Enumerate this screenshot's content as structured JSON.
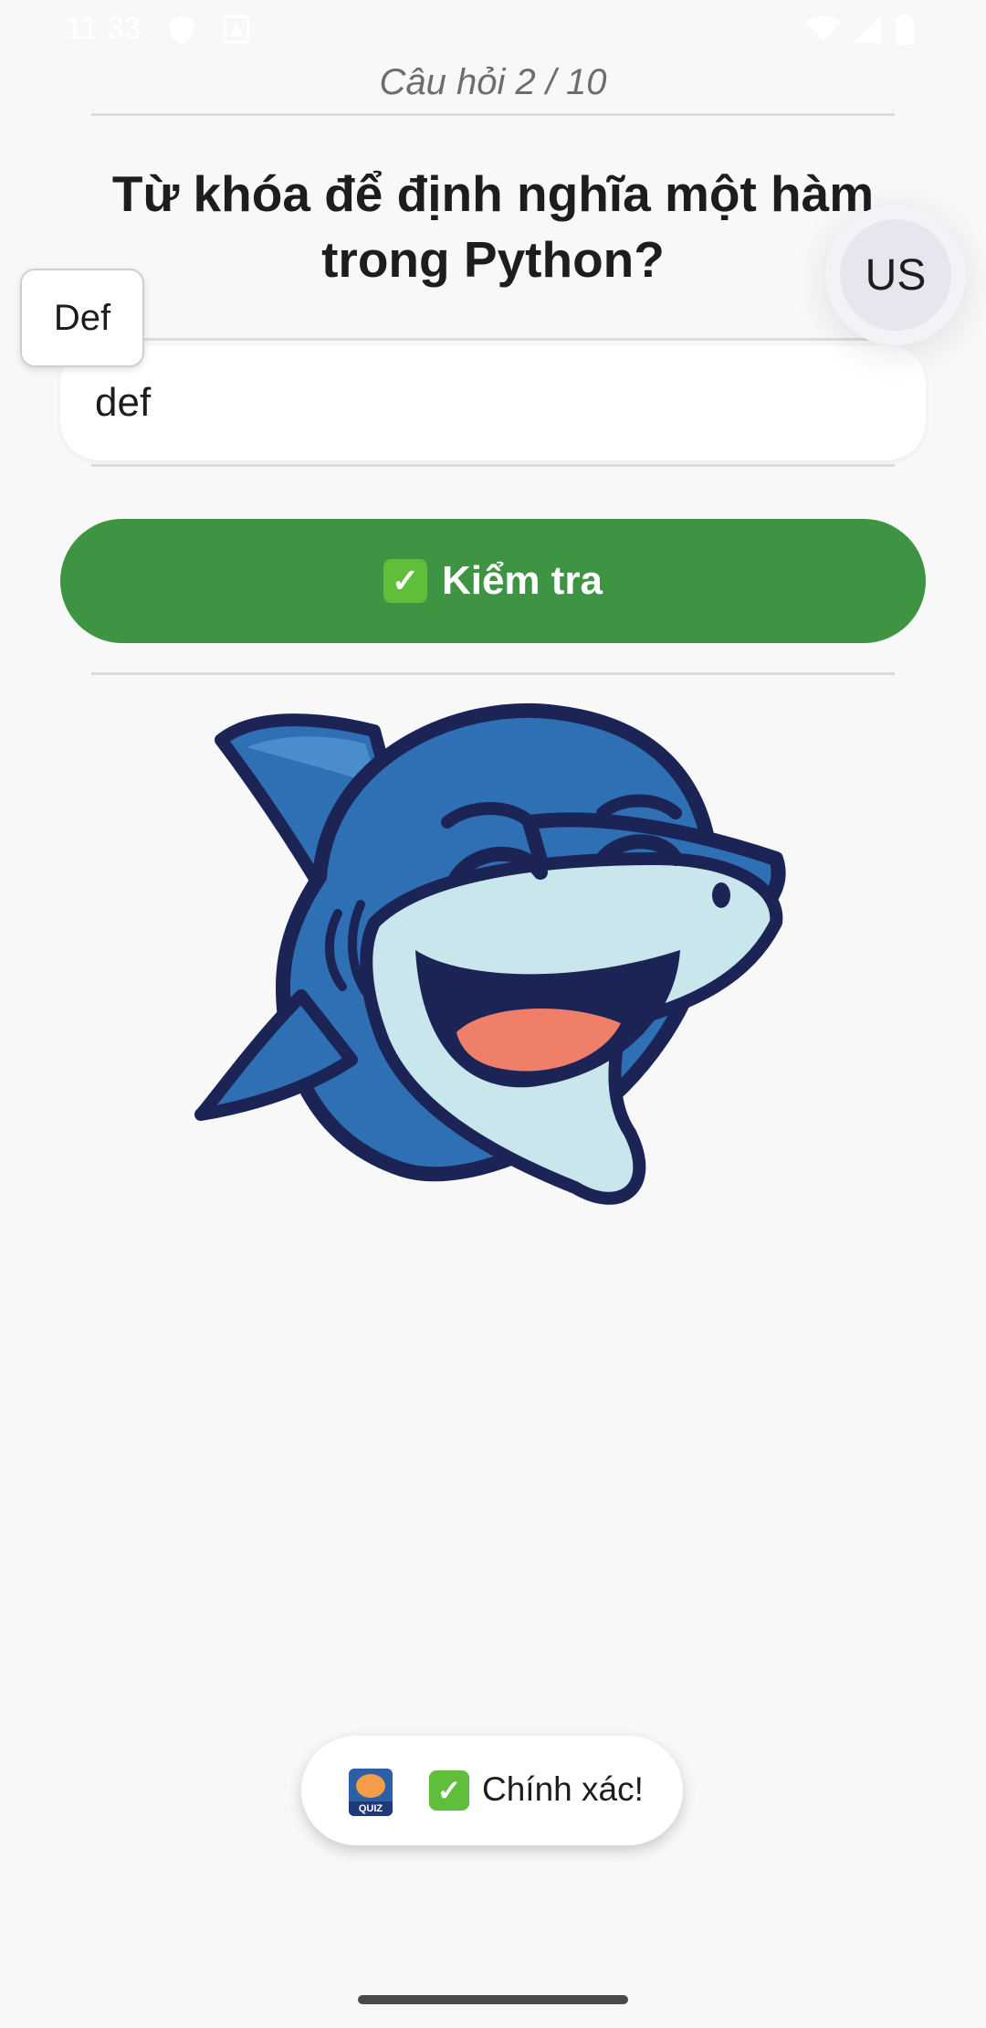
{
  "status_bar": {
    "time": "11:33"
  },
  "quiz": {
    "counter": "Câu hỏi 2 / 10",
    "question": "Từ khóa để định nghĩa một hàm trong Python?",
    "answer_value": "def",
    "check_button_label": "Kiểm tra",
    "check_emoji": "✓"
  },
  "suggestion": {
    "label": "Def"
  },
  "avatar": {
    "initials": "US"
  },
  "toast": {
    "check_emoji": "✓",
    "message": "Chính xác!",
    "logo_text": "QUIZ"
  },
  "colors": {
    "accent_green": "#3e9443",
    "background": "#f8f8f8",
    "shark_blue": "#2f6fb3",
    "shark_outline": "#1c2456",
    "shark_belly": "#c8e6ec",
    "tongue": "#f07f6a"
  },
  "icons": {
    "status": [
      "shield-icon",
      "notification-icon",
      "wifi-icon",
      "signal-icon",
      "battery-icon"
    ],
    "mascot": "shark-mascot-image"
  }
}
